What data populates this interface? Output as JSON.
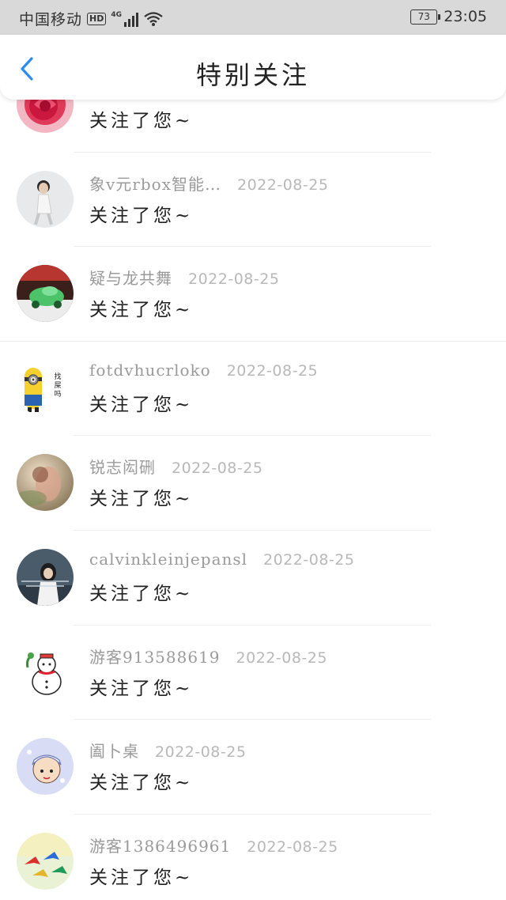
{
  "status_bar": {
    "carrier": "中国移动",
    "hd": "HD",
    "network": "4G",
    "battery": "73",
    "time": "23:05"
  },
  "nav": {
    "title": "特别关注",
    "back_icon": "chevron-left-icon",
    "accent": "#2d8cf0"
  },
  "items": [
    {
      "name": "",
      "date": "",
      "message": "关注了您~",
      "avatar": "red-rose-avatar"
    },
    {
      "name": "象v元rbox智能…",
      "date": "2022-08-25",
      "message": "关注了您~",
      "avatar": "boy-photo-avatar"
    },
    {
      "name": "疑与龙共舞",
      "date": "2022-08-25",
      "message": "关注了您~",
      "avatar": "green-toy-car-avatar"
    },
    {
      "name": "fotdvhucrloko",
      "date": "2022-08-25",
      "message": "关注了您~",
      "avatar": "minion-avatar",
      "avatar_text": "找\n屎\n吗"
    },
    {
      "name": "锐志闳硎",
      "date": "2022-08-25",
      "message": "关注了您~",
      "avatar": "girl-painting-avatar"
    },
    {
      "name": "calvinkleinjepansl",
      "date": "2022-08-25",
      "message": "关注了您~",
      "avatar": "girl-text-avatar"
    },
    {
      "name": "游客913588619",
      "date": "2022-08-25",
      "message": "关注了您~",
      "avatar": "snowman-avatar"
    },
    {
      "name": "阖卜桌",
      "date": "2022-08-25",
      "message": "关注了您~",
      "avatar": "cartoon-kid-avatar"
    },
    {
      "name": "游客1386496961",
      "date": "2022-08-25",
      "message": "关注了您~",
      "avatar": "paper-cranes-avatar"
    }
  ]
}
